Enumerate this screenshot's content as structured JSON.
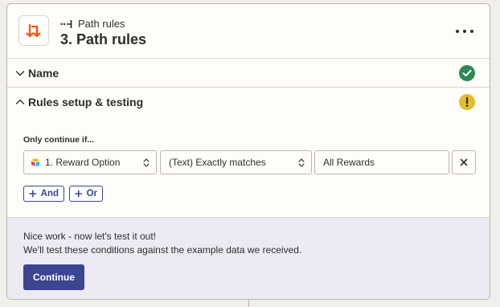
{
  "header": {
    "app_icon": "path-arrows-icon",
    "subtitle": "Path rules",
    "subtitle_icon": "path-glyph-icon",
    "title": "3. Path rules",
    "more_icon": "more-horizontal-icon"
  },
  "sections": {
    "name": {
      "label": "Name",
      "status": "complete",
      "status_color": "#2b8a54"
    },
    "rules": {
      "label": "Rules setup & testing",
      "status": "warning",
      "status_color": "#e2bd2c"
    }
  },
  "rule": {
    "intro": "Only continue if...",
    "field": "1. Reward Option",
    "operator": "(Text) Exactly matches",
    "value": "All Rewards"
  },
  "buttons": {
    "and_label": "And",
    "or_label": "Or",
    "continue_label": "Continue"
  },
  "test": {
    "title": "Nice work - now let's test it out!",
    "description": "We'll test these conditions against the example data we received."
  },
  "colors": {
    "accent": "#3d4592",
    "brand_orange": "#ff4f00",
    "panel_bg": "#eceaf3"
  }
}
